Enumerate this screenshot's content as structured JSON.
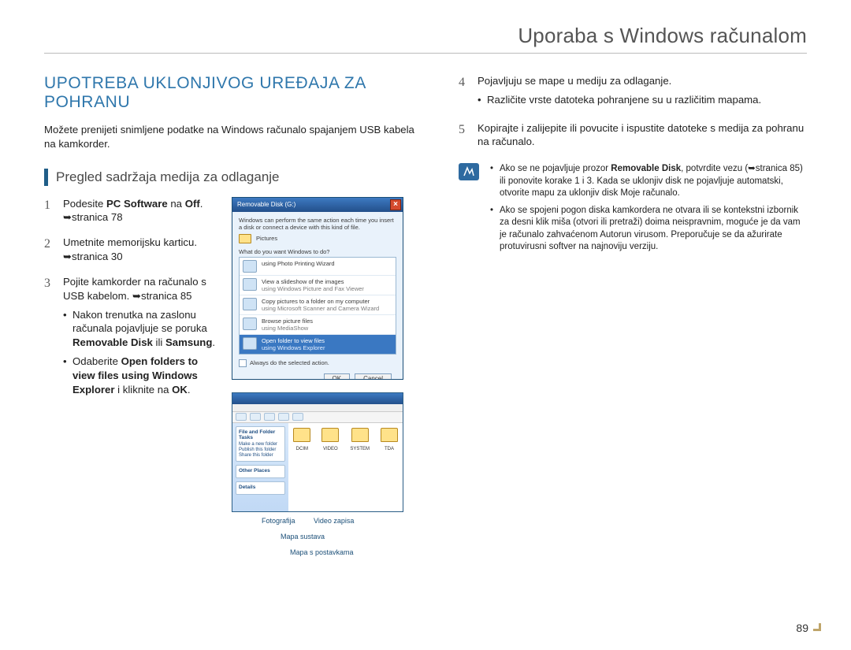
{
  "header": {
    "title": "Uporaba s Windows računalom"
  },
  "section": {
    "heading": "UPOTREBA UKLONJIVOG UREĐAJA ZA POHRANU",
    "intro": "Možete prenijeti snimljene podatke na Windows računalo spajanjem USB kabela na kamkorder.",
    "subheading": "Pregled sadržaja medija za odlaganje"
  },
  "leftSteps": [
    {
      "num": "1",
      "parts": [
        "Podesite ",
        "PC Software",
        " na ",
        "Off",
        ". ",
        "➥stranica 78"
      ]
    },
    {
      "num": "2",
      "parts": [
        "Umetnite memorijsku karticu. ➥stranica 30"
      ]
    },
    {
      "num": "3",
      "parts": [
        "Pojite kamkorder na računalo s USB kabelom. ➥stranica 85"
      ],
      "subs": [
        "Nakon trenutka na zaslonu računala pojavljuje se poruka <b>Removable Disk</b> ili <b>Samsung</b>.",
        "Odaberite <b>Open folders to view files using Windows Explorer</b> i kliknite na <b>OK</b>."
      ]
    }
  ],
  "rightSteps": [
    {
      "num": "4",
      "text": "Pojavljuju se mape u mediju za odlaganje.",
      "subs": [
        "Različite vrste datoteka pohranjene su u različitim mapama."
      ]
    },
    {
      "num": "5",
      "text": "Kopirajte i zalijepite ili povucite i ispustite datoteke s medija za pohranu na računalo."
    }
  ],
  "notes": [
    "Ako se ne pojavljuje prozor <b>Removable Disk</b>, potvrdite vezu (➥stranica 85) ili ponovite korake 1 i 3. Kada se uklonjiv disk ne pojavljuje automatski, otvorite mapu za uklonjiv disk Moje računalo.",
    "Ako se spojeni pogon diska kamkordera ne otvara ili se kontekstni izbornik za desni klik miša (otvori ili pretraži) doima neispravnim, moguće je da vam je računalo zahvaćenom Autorun virusom. Preporučuje se da ažurirate protuvirusni softver na najnoviju verziju."
  ],
  "dialog": {
    "title": "Removable Disk (G:)",
    "desc": "Windows can perform the same action each time you insert a disk or connect a device with this kind of file.",
    "picturesLabel": "Pictures",
    "prompt": "What do you want Windows to do?",
    "items": [
      {
        "main": "using Photo Printing Wizard"
      },
      {
        "main": "View a slideshow of the images",
        "sub": "using Windows Picture and Fax Viewer"
      },
      {
        "main": "Copy pictures to a folder on my computer",
        "sub": "using Microsoft Scanner and Camera Wizard"
      },
      {
        "main": "Browse picture files",
        "sub": "using MediaShow"
      },
      {
        "main": "Open folder to view files",
        "sub": "using Windows Explorer",
        "selected": true
      }
    ],
    "always": "Always do the selected action.",
    "ok": "OK",
    "cancel": "Cancel"
  },
  "explorer": {
    "sidePanels": [
      {
        "hd": "File and Folder Tasks",
        "links": [
          "Make a new folder",
          "Publish this folder",
          "Share this folder"
        ]
      },
      {
        "hd": "Other Places"
      },
      {
        "hd": "Details"
      }
    ],
    "folders": [
      "DCIM",
      "VIDEO",
      "SYSTEM",
      "TDA"
    ]
  },
  "callouts": {
    "photo": "Fotografija",
    "video": "Video zapisa",
    "system": "Mapa sustava",
    "settings": "Mapa s postavkama"
  },
  "pageNumber": "89"
}
